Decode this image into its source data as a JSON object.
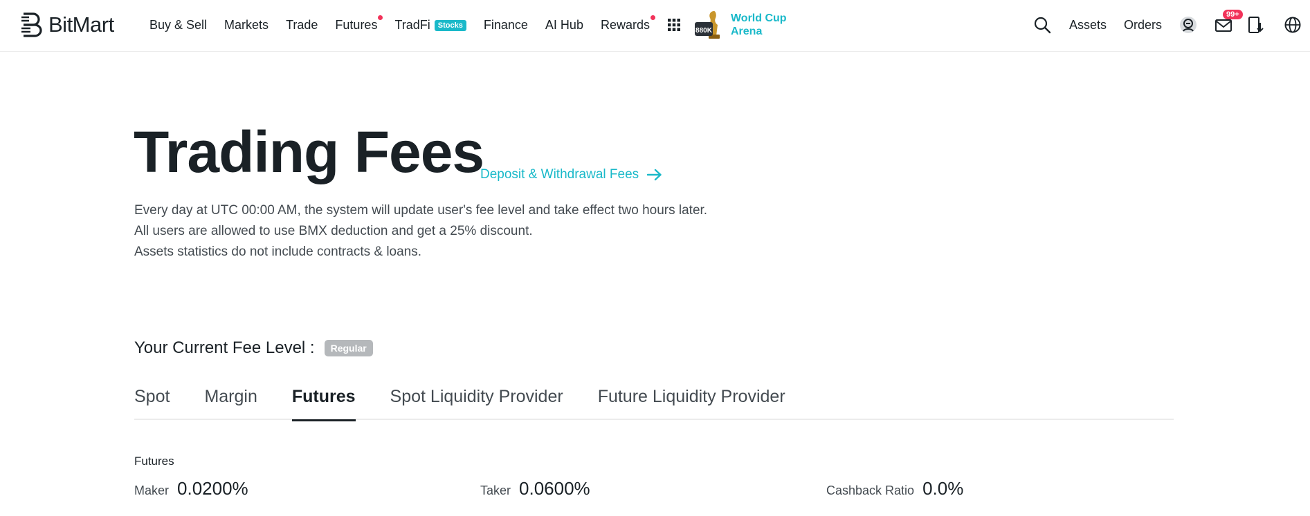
{
  "brand": {
    "name": "BitMart"
  },
  "nav": {
    "items": [
      {
        "label": "Buy & Sell",
        "dot": false
      },
      {
        "label": "Markets",
        "dot": false
      },
      {
        "label": "Trade",
        "dot": false
      },
      {
        "label": "Futures",
        "dot": true
      },
      {
        "label": "TradFi",
        "dot": false,
        "badge": "Stocks"
      },
      {
        "label": "Finance",
        "dot": false
      },
      {
        "label": "AI Hub",
        "dot": false
      },
      {
        "label": "Rewards",
        "dot": true
      }
    ],
    "promo": {
      "line1": "World Cup",
      "line2": "Arena",
      "trophy_text": "880K"
    }
  },
  "right_nav": {
    "assets": "Assets",
    "orders": "Orders",
    "notifications_badge": "99+"
  },
  "page": {
    "title": "Trading Fees",
    "deposit_link": "Deposit & Withdrawal Fees",
    "desc_1": "Every day at UTC 00:00 AM, the system will update user's fee level and take effect two hours later.",
    "desc_2": "All users are allowed to use BMX deduction and get a 25% discount.",
    "desc_3": "Assets statistics do not include contracts & loans.",
    "fee_level_label": "Your Current Fee Level :",
    "fee_level_value": "Regular"
  },
  "tabs": [
    {
      "label": "Spot",
      "active": false
    },
    {
      "label": "Margin",
      "active": false
    },
    {
      "label": "Futures",
      "active": true
    },
    {
      "label": "Spot Liquidity Provider",
      "active": false
    },
    {
      "label": "Future Liquidity Provider",
      "active": false
    }
  ],
  "section": {
    "title": "Futures",
    "maker_label": "Maker",
    "maker_value": "0.0200%",
    "taker_label": "Taker",
    "taker_value": "0.0600%",
    "cashback_label": "Cashback Ratio",
    "cashback_value": "0.0%"
  },
  "colors": {
    "accent": "#1ab9c9",
    "dot": "#f2335a",
    "badge": "#b5b8bb",
    "text": "#1a2126"
  }
}
